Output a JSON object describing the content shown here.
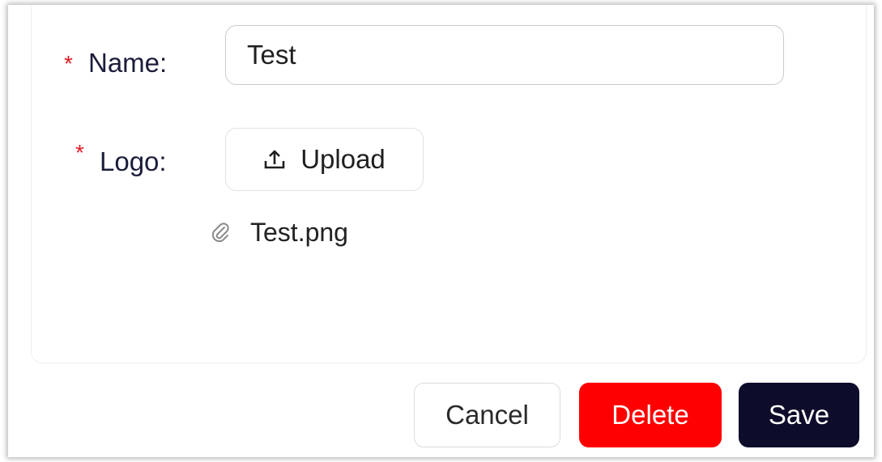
{
  "form": {
    "required_marker": "*",
    "name_label": "Name:",
    "name_value": "Test",
    "logo_label": "Logo:",
    "upload_label": "Upload",
    "file_name": "Test.png"
  },
  "actions": {
    "cancel_label": "Cancel",
    "delete_label": "Delete",
    "save_label": "Save"
  },
  "icons": {
    "upload": "upload-icon",
    "attachment": "paperclip-icon"
  },
  "colors": {
    "required": "#e31b23",
    "label_text": "#1b1d3b",
    "delete_bg": "#ff0000",
    "save_bg": "#0d0d2b"
  }
}
